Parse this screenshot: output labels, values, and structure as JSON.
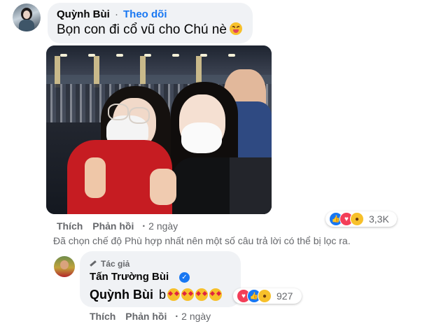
{
  "comment1": {
    "author": "Quỳnh Bùi",
    "separator": "·",
    "follow_label": "Theo dõi",
    "text": "Bọn con đi cổ vũ cho Chú nè",
    "emoji": "squinting-face-with-tongue",
    "actions": {
      "like": "Thích",
      "reply": "Phản hồi",
      "time": "2 ngày"
    },
    "reactions": {
      "icons": [
        "like-icon",
        "love-icon",
        "haha-icon"
      ],
      "count": "3,3K"
    },
    "photo": "two-girls-at-stadium-photo"
  },
  "filter_note": "Đã chọn chế độ Phù hợp nhất nên một số câu trả lời có thể bị lọc ra.",
  "reply": {
    "badge": "Tác giả",
    "author": "Tấn Trường Bùi",
    "verified": true,
    "mention": "Quỳnh Bùi",
    "text": "b",
    "emojis": [
      "smiling-face-with-hearts",
      "smiling-face-with-hearts",
      "smiling-face-with-hearts",
      "smiling-face-with-hearts"
    ],
    "reactions": {
      "icons": [
        "love-icon",
        "like-icon",
        "haha-icon"
      ],
      "count": "927"
    },
    "actions": {
      "like": "Thích",
      "reply": "Phản hồi",
      "time": "2 ngày"
    }
  },
  "colors": {
    "link_blue": "#1877f2",
    "bubble_bg": "#f0f2f5",
    "secondary_text": "#65676b"
  }
}
